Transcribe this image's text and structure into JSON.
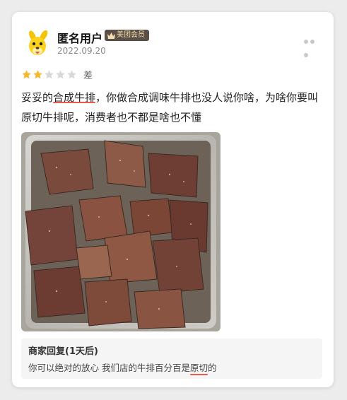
{
  "review": {
    "user_name": "匿名用户",
    "member_badge": "美团会员",
    "date": "2022.09.20",
    "rating": {
      "value": 2,
      "max": 5,
      "label": "差"
    },
    "text_parts": {
      "p1": "妥妥的",
      "p2": "合成牛排",
      "p3": "，你做合成调味牛排也没人说你啥，为啥你要叫原切牛排呢，消费者也不都是啥也不懂"
    }
  },
  "merchant_reply": {
    "title": "商家回复(1天后)",
    "text_parts": {
      "p1": "你可以绝对的放心  我们店的牛排百分百是",
      "p2": "原切",
      "p3": "的"
    }
  },
  "colors": {
    "star_filled": "#f7b731",
    "star_empty": "#d9d9d9",
    "underline": "#e85a4f",
    "badge_bg": "#5b5048"
  },
  "icons": {
    "more": "more-icon",
    "avatar": "yellow-dog-mascot-avatar",
    "badge": "crown-icon"
  }
}
